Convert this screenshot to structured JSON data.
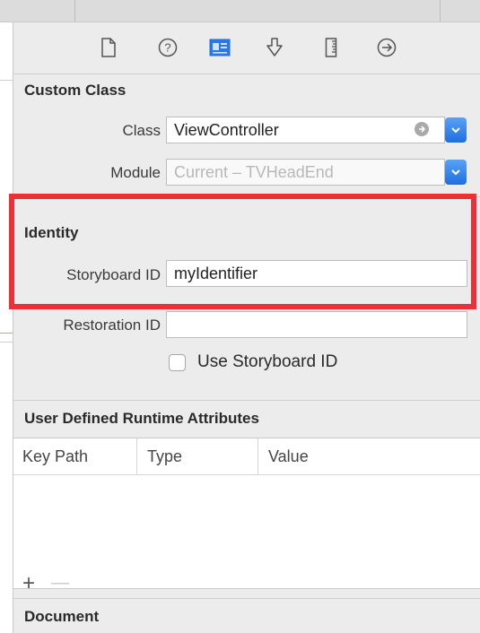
{
  "tabs": [
    {
      "icon": "file-icon"
    },
    {
      "icon": "help-icon"
    },
    {
      "icon": "identity-icon",
      "selected": true
    },
    {
      "icon": "attributes-icon"
    },
    {
      "icon": "size-icon"
    },
    {
      "icon": "connections-icon"
    }
  ],
  "custom_class": {
    "header": "Custom Class",
    "class_label": "Class",
    "class_value": "ViewController",
    "module_label": "Module",
    "module_placeholder": "Current – TVHeadEnd"
  },
  "identity": {
    "header": "Identity",
    "storyboard_id_label": "Storyboard ID",
    "storyboard_id_value": "myIdentifier",
    "restoration_id_label": "Restoration ID",
    "restoration_id_value": "",
    "use_storyboard_id_label": "Use Storyboard ID",
    "use_storyboard_id_checked": false
  },
  "runtime_attributes": {
    "header": "User Defined Runtime Attributes",
    "columns": [
      "Key Path",
      "Type",
      "Value"
    ],
    "rows": [],
    "add_label": "+",
    "remove_label": "—"
  },
  "document": {
    "header": "Document"
  },
  "colors": {
    "accent": "#1c6fe0",
    "highlight_border": "#ee2f36"
  }
}
